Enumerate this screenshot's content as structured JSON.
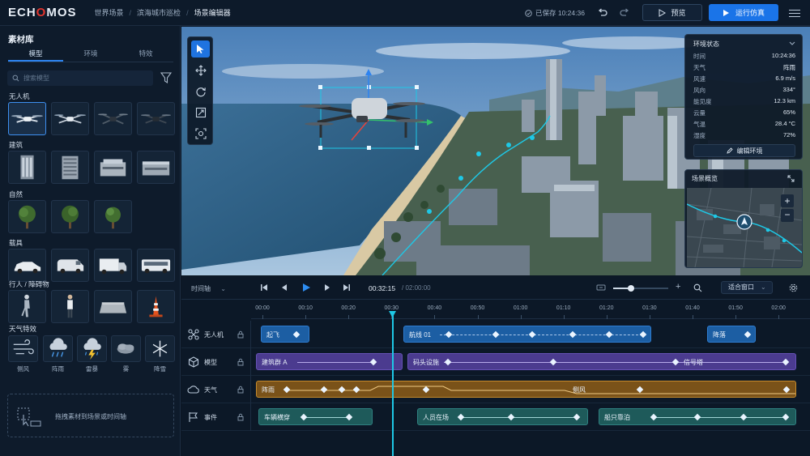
{
  "app": {
    "logo_a": "ECH",
    "logo_b": "O",
    "logo_c": "MOS"
  },
  "breadcrumb": [
    "世界场景",
    "滨海城市巡检",
    "场景编辑器"
  ],
  "save_status": "已保存 10:24:36",
  "buttons": {
    "preview": "预览",
    "run": "运行仿真"
  },
  "library": {
    "title": "素材库",
    "tabs": [
      "模型",
      "环境",
      "特效"
    ],
    "search_placeholder": "搜索模型",
    "categories": {
      "drone": "无人机",
      "building": "建筑",
      "nature": "自然",
      "vehicle": "载具",
      "pedestrian": "行人 / 障碍物",
      "weather": "天气特效"
    },
    "weather_items": [
      "侧风",
      "阵雨",
      "雷暴",
      "雾",
      "降雪"
    ],
    "drop_hint": "拖拽素材到场景或时间轴"
  },
  "env": {
    "title": "环境状态",
    "rows": [
      {
        "k": "时间",
        "v": "10:24:36"
      },
      {
        "k": "天气",
        "v": "阵雨"
      },
      {
        "k": "风速",
        "v": "6.9 m/s"
      },
      {
        "k": "风向",
        "v": "334°"
      },
      {
        "k": "能见度",
        "v": "12.3 km"
      },
      {
        "k": "云量",
        "v": "65%"
      },
      {
        "k": "气温",
        "v": "28.4 °C"
      },
      {
        "k": "湿度",
        "v": "72%"
      }
    ],
    "edit_button": "编辑环境"
  },
  "overview": {
    "title": "场景概览"
  },
  "timeline": {
    "mode": "时间轴",
    "current": "00:32:15",
    "total": "/ 02:00:00",
    "fit": "适合窗口",
    "ticks": [
      "00:00",
      "00:10",
      "00:20",
      "00:30",
      "00:40",
      "00:50",
      "01:00",
      "01:10",
      "01:20",
      "01:30",
      "01:40",
      "01:50",
      "02:00"
    ],
    "tracks": [
      "无人机",
      "模型",
      "天气",
      "事件"
    ],
    "clips": {
      "drone": [
        "起飞",
        "航线 01",
        "降落"
      ],
      "model": [
        "建筑群 A",
        "码头设施",
        "信号塔"
      ],
      "weather": [
        "阵雨",
        "侧风"
      ],
      "event": [
        "车辆横穿",
        "人员在场",
        "船只靠泊"
      ]
    }
  },
  "colors": {
    "accent": "#1a74e8",
    "playhead": "#1ec8e6",
    "logo_red": "#e2342d"
  }
}
